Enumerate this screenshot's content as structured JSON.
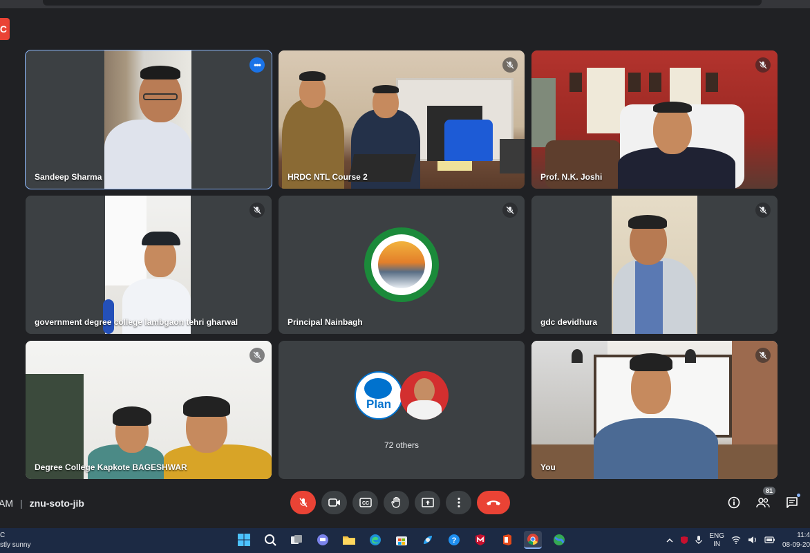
{
  "browser": {
    "url_fragment": "…"
  },
  "recording_badge": "C",
  "participants": [
    {
      "name": "Sandeep Sharma"
    },
    {
      "name": "HRDC NTL Course 2"
    },
    {
      "name": "Prof. N.K. Joshi"
    },
    {
      "name": "government degree college lambgaon tehri gharwal"
    },
    {
      "name": "Principal Nainbagh"
    },
    {
      "name": "gdc devidhura"
    },
    {
      "name": "Degree College Kapkote BAGESHWAR"
    },
    {
      "name": "72 others",
      "avatar_text": "Plan"
    },
    {
      "name": "You"
    }
  ],
  "meeting": {
    "time_suffix": "AM",
    "code": "znu-soto-jib"
  },
  "participant_count": "81",
  "taskbar": {
    "weather_line1": "C",
    "weather_line2": "stly sunny",
    "lang_line1": "ENG",
    "lang_line2": "IN",
    "time": "11:4",
    "date": "08-09-202"
  }
}
